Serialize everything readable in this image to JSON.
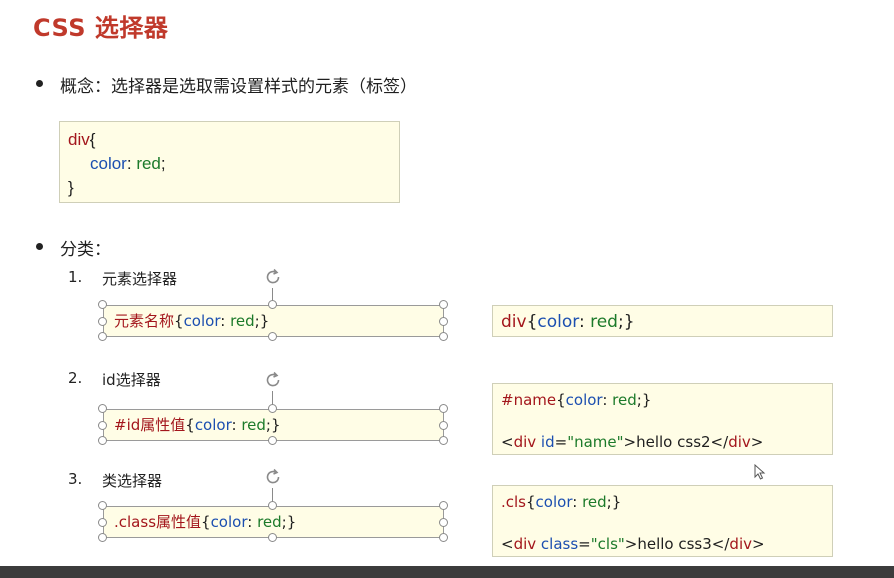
{
  "title": "CSS 选择器",
  "concept": {
    "text": "概念：选择器是选取需设置样式的元素（标签）"
  },
  "code_example": {
    "line1_selector": "div",
    "line1_brace": "{",
    "line2_prop": "color",
    "line2_colon": ": ",
    "line2_value": "red",
    "line2_semicolon": ";",
    "line3_brace": "}"
  },
  "category": {
    "text": "分类："
  },
  "selectors": [
    {
      "number": "1.",
      "label": "元素选择器",
      "syntax_selector": "元素名称",
      "syntax_open": "{",
      "syntax_prop": "color",
      "syntax_colon": ": ",
      "syntax_value": "red",
      "syntax_close": ";}",
      "example": {
        "sel": "div",
        "open": "{",
        "prop": "color",
        "colon": ": ",
        "value": "red",
        "close": ";}"
      }
    },
    {
      "number": "2.",
      "label": "id选择器",
      "syntax_selector": "#id属性值",
      "syntax_open": "{",
      "syntax_prop": "color",
      "syntax_colon": ": ",
      "syntax_value": "red",
      "syntax_close": ";}",
      "example": {
        "sel": "#name",
        "open": "{",
        "prop": "color",
        "colon": ": ",
        "value": "red",
        "close": ";}",
        "html_open": "<",
        "html_tag": "div",
        "html_attr": " id",
        "html_eq": "=",
        "html_val": "\"name\"",
        "html_gt": ">hello css2</",
        "html_tag_close": "div",
        "html_end": ">"
      }
    },
    {
      "number": "3.",
      "label": "类选择器",
      "syntax_selector": ".class属性值",
      "syntax_open": "{",
      "syntax_prop": "color",
      "syntax_colon": ": ",
      "syntax_value": "red",
      "syntax_close": ";}",
      "example": {
        "sel": ".cls",
        "open": "{",
        "prop": "color",
        "colon": ": ",
        "value": "red",
        "close": ";}",
        "html_open": "<",
        "html_tag": "div",
        "html_attr": " class",
        "html_eq": "=",
        "html_val": "\"cls\"",
        "html_gt": ">hello css3</",
        "html_tag_close": "div",
        "html_end": ">"
      }
    }
  ],
  "colors": {
    "title": "#c0392b",
    "selector": "#a3161c",
    "property": "#1c4fb0",
    "value": "#1c7a2a",
    "box_fill": "#fffde6"
  }
}
